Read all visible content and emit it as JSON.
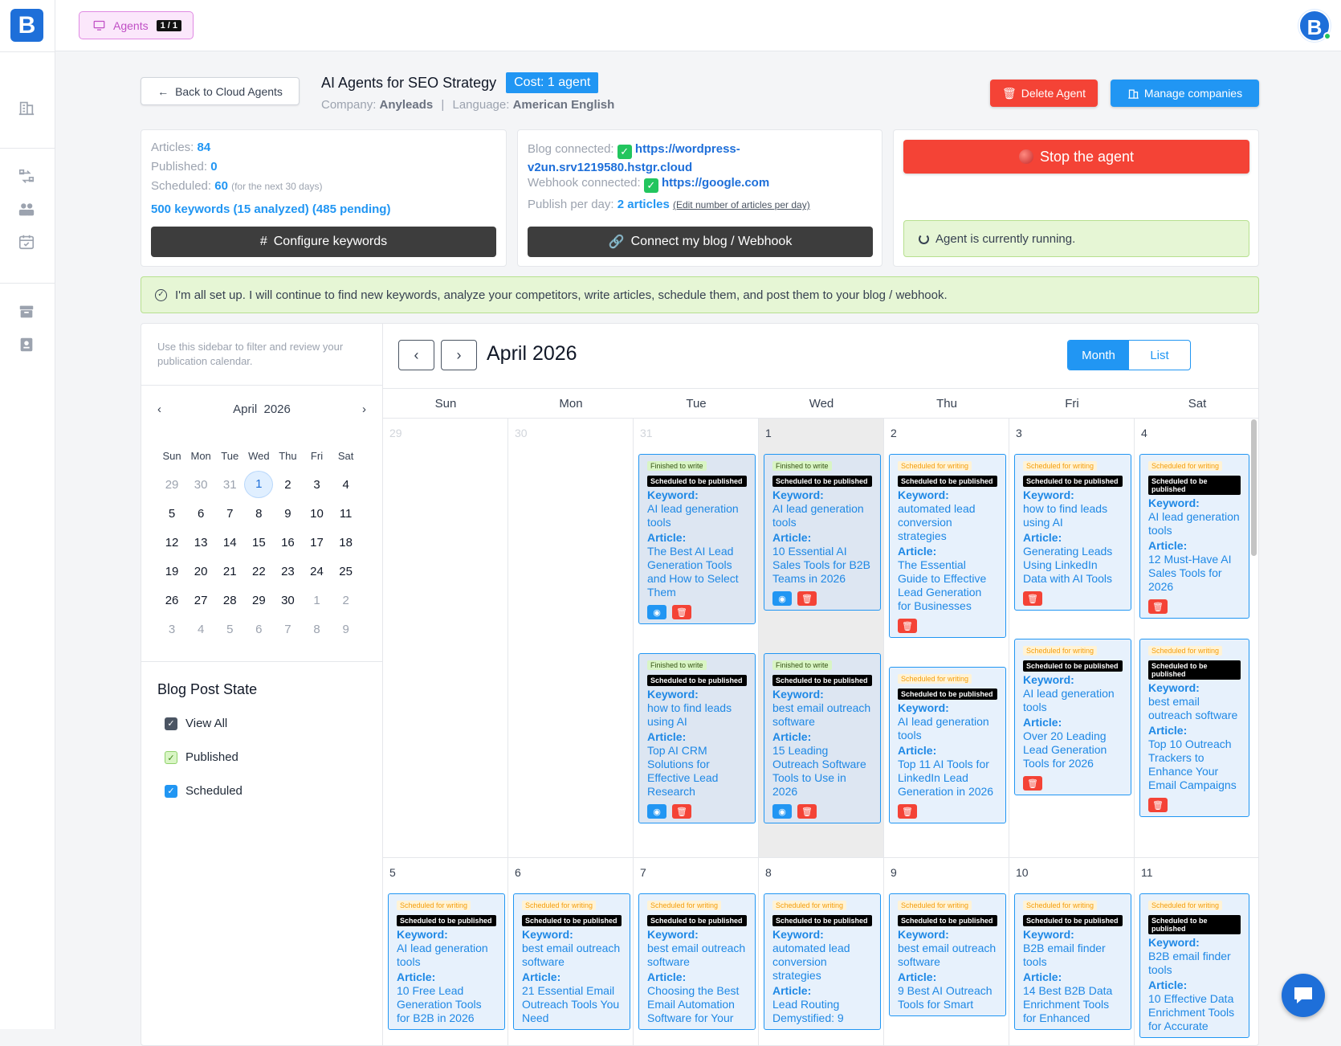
{
  "app": {
    "logo": "B",
    "avatar_letter": "B"
  },
  "topbar": {
    "agents_label": "Agents",
    "agents_count": "1 / 1"
  },
  "agent": {
    "back_label": "Back to Cloud Agents",
    "title": "AI Agents for SEO Strategy",
    "cost": "Cost: 1 agent",
    "company_label": "Company:",
    "company": "Anyleads",
    "language_label": "Language:",
    "language": "American English",
    "delete_label": "Delete Agent",
    "manage_label": "Manage companies"
  },
  "stats": {
    "articles_label": "Articles:",
    "articles": "84",
    "published_label": "Published:",
    "published": "0",
    "scheduled_label": "Scheduled:",
    "scheduled": "60",
    "scheduled_note": "(for the next 30 days)",
    "keywords": "500 keywords (15 analyzed) (485 pending)",
    "configure_label": "Configure keywords"
  },
  "blog": {
    "blog_label": "Blog connected:",
    "blog_url_1": "https://wordpress-",
    "blog_url_2": "v2un.srv1219580.hstgr.cloud",
    "webhook_label": "Webhook connected:",
    "webhook_url": "https://google.com",
    "perday_label": "Publish per day:",
    "perday": "2 articles",
    "edit_label": "(Edit number of articles per day)",
    "connect_label": "Connect my blog / Webhook"
  },
  "status": {
    "stop_label": "Stop the agent",
    "running": "Agent is currently running."
  },
  "setup_msg": "I'm all set up. I will continue to find new keywords, analyze your competitors, write articles, schedule them, and post them to your blog / webhook.",
  "sidebar": {
    "hint": "Use this sidebar to filter and review your publication calendar.",
    "mini_month": "April  2026",
    "weekdays": [
      "Sun",
      "Mon",
      "Tue",
      "Wed",
      "Thu",
      "Fri",
      "Sat"
    ],
    "state_title": "Blog Post State",
    "filters": [
      "View All",
      "Published",
      "Scheduled"
    ]
  },
  "calendar": {
    "title": "April 2026",
    "view_month": "Month",
    "view_list": "List",
    "day_heads": [
      "Sun",
      "Mon",
      "Tue",
      "Wed",
      "Thu",
      "Fri",
      "Sat"
    ]
  },
  "labels": {
    "keyword": "Keyword:",
    "article": "Article:",
    "finished": "Finished to write",
    "scheduled_writing": "Scheduled for writing",
    "to_publish": "Scheduled to be published"
  },
  "events": {
    "tue31a": {
      "keyword": "AI lead generation tools",
      "article": "The Best AI Lead Generation Tools and How to Select Them"
    },
    "tue31b": {
      "keyword": "how to find leads using AI",
      "article": "Top AI CRM Solutions for Effective Lead Research"
    },
    "wed1a": {
      "keyword": "AI lead generation tools",
      "article": "10 Essential AI Sales Tools for B2B Teams in 2026"
    },
    "wed1b": {
      "keyword": "best email outreach software",
      "article": "15 Leading Outreach Software Tools to Use in 2026"
    },
    "thu2a": {
      "keyword": "automated lead conversion strategies",
      "article": "The Essential Guide to Effective Lead Generation for Businesses"
    },
    "thu2b": {
      "keyword": "AI lead generation tools",
      "article": "Top 11 AI Tools for LinkedIn Lead Generation in 2026"
    },
    "fri3a": {
      "keyword": "how to find leads using AI",
      "article": "Generating Leads Using LinkedIn Data with AI Tools"
    },
    "fri3b": {
      "keyword": "AI lead generation tools",
      "article": "Over 20 Leading Lead Generation Tools for 2026"
    },
    "sat4a": {
      "keyword": "AI lead generation tools",
      "article": "12 Must-Have AI Sales Tools for 2026"
    },
    "sat4b": {
      "keyword": "best email outreach software",
      "article": "Top 10 Outreach Trackers to Enhance Your Email Campaigns"
    },
    "sun5": {
      "keyword": "AI lead generation tools",
      "article": "10 Free Lead Generation Tools for B2B in 2026"
    },
    "mon6": {
      "keyword": "best email outreach software",
      "article": "21 Essential Email Outreach Tools You Need"
    },
    "tue7": {
      "keyword": "best email outreach software",
      "article": "Choosing the Best Email Automation Software for Your"
    },
    "wed8": {
      "keyword": "automated lead conversion strategies",
      "article": "Lead Routing Demystified: 9"
    },
    "thu9": {
      "keyword": "best email outreach software",
      "article": "9 Best AI Outreach Tools for Smart"
    },
    "fri10": {
      "keyword": "B2B email finder tools",
      "article": "14 Best B2B Data Enrichment Tools for Enhanced"
    },
    "sat11": {
      "keyword": "B2B email finder tools",
      "article": "10 Effective Data Enrichment Tools for Accurate"
    }
  },
  "colors": {
    "brand": "#1e6fd9",
    "accent": "#2196f3",
    "danger": "#f44336",
    "success_bg": "#e6f6d5"
  }
}
